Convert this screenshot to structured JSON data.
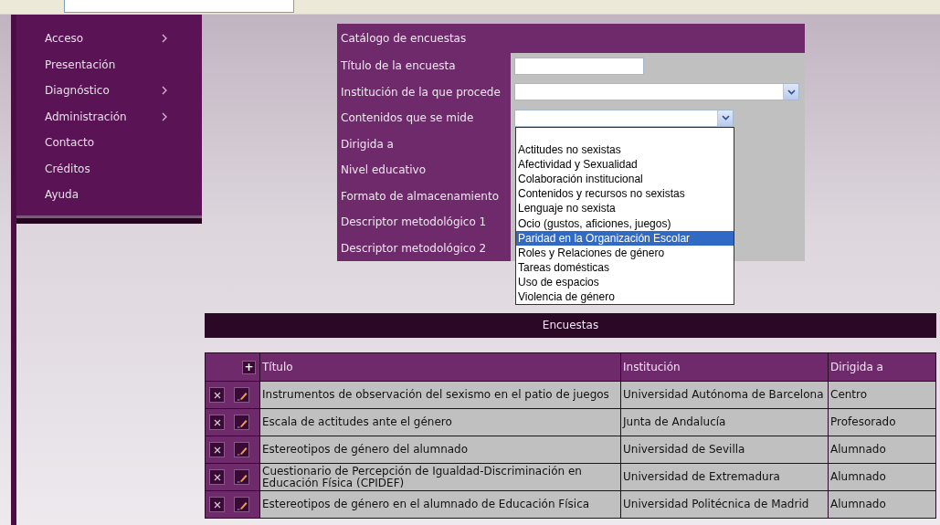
{
  "sidebar": {
    "items": [
      {
        "label": "Acceso",
        "has_submenu": true
      },
      {
        "label": "Presentación",
        "has_submenu": false
      },
      {
        "label": "Diagnóstico",
        "has_submenu": true
      },
      {
        "label": "Administración",
        "has_submenu": true
      },
      {
        "label": "Contacto",
        "has_submenu": false
      },
      {
        "label": "Créditos",
        "has_submenu": false
      },
      {
        "label": "Ayuda",
        "has_submenu": false
      }
    ]
  },
  "search_form": {
    "title": "Catálogo de encuestas",
    "fields": [
      {
        "label": "Título de la encuesta",
        "kind": "text"
      },
      {
        "label": "Institución de la que procede",
        "kind": "select"
      },
      {
        "label": "Contenidos que se mide",
        "kind": "select",
        "expanded": true,
        "options": [
          {
            "selected": false
          },
          {
            "label": "Actitudes no sexistas",
            "selected": false
          },
          {
            "label": "Afectividad y Sexualidad",
            "selected": false
          },
          {
            "label": "Colaboración institucional",
            "selected": false
          },
          {
            "label": "Contenidos y recursos no sexistas",
            "selected": false
          },
          {
            "label": "Lenguaje no sexista",
            "selected": false
          },
          {
            "label": "Ocio (gustos, aficiones, juegos)",
            "selected": false
          },
          {
            "label": "Paridad en la Organización Escolar",
            "selected": true
          },
          {
            "label": "Roles y Relaciones de género",
            "selected": false
          },
          {
            "label": "Tareas domésticas",
            "selected": false
          },
          {
            "label": "Uso de espacios",
            "selected": false
          },
          {
            "label": "Violencia de género",
            "selected": false
          }
        ]
      },
      {
        "label": "Dirigida a"
      },
      {
        "label": "Nivel educativo"
      },
      {
        "label": "Formato de almacenamiento"
      },
      {
        "label": "Descriptor metodológico 1"
      },
      {
        "label": "Descriptor metodológico 2"
      }
    ]
  },
  "table": {
    "title": "Encuestas",
    "add_button": "+",
    "columns": [
      "Título",
      "Institución",
      "Dirigida a"
    ],
    "rows": [
      {
        "cells": [
          "Instrumentos de observación del sexismo en el patio de juegos",
          "Universidad Autónoma de Barcelona",
          "Centro"
        ]
      },
      {
        "cells": [
          "Escala de actitudes ante el género",
          "Junta de Andalucía",
          "Profesorado"
        ]
      },
      {
        "cells": [
          "Estereotipos de género del alumnado",
          "Universidad de Sevilla",
          "Alumnado"
        ]
      },
      {
        "cells": [
          "Cuestionario de Percepción de Igualdad-Discriminación en Educación Física (CPIDEF)",
          "Universidad de Extremadura",
          "Alumnado"
        ]
      },
      {
        "cells": [
          "Estereotipos de género en el alumnado de Educación Física",
          "Universidad Politécnica de Madrid",
          "Alumnado"
        ]
      }
    ]
  }
}
